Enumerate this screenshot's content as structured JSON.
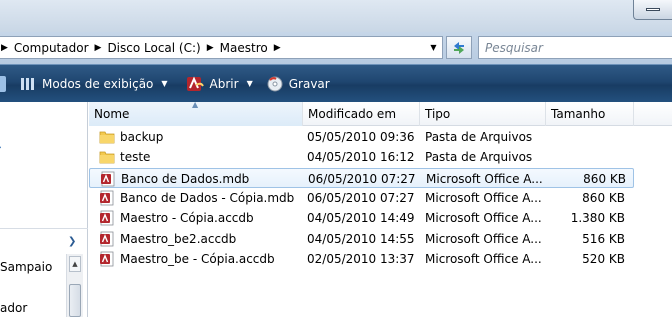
{
  "address": {
    "crumbs": [
      "Computador",
      "Disco Local (C:)",
      "Maestro"
    ],
    "search_placeholder": "Pesquisar"
  },
  "toolbar": {
    "views_label": "Modos de exibição",
    "open_label": "Abrir",
    "burn_label": "Gravar"
  },
  "nav": {
    "items": [
      "Sampaio",
      "ador"
    ]
  },
  "columns": {
    "name": "Nome",
    "modified": "Modificado em",
    "type": "Tipo",
    "size": "Tamanho"
  },
  "files": [
    {
      "name": "backup",
      "modified": "05/05/2010 09:36",
      "type": "Pasta de Arquivos",
      "size": "",
      "icon": "folder-icon"
    },
    {
      "name": "teste",
      "modified": "04/05/2010 16:12",
      "type": "Pasta de Arquivos",
      "size": "",
      "icon": "folder-icon"
    },
    {
      "name": "Banco de Dados.mdb",
      "modified": "06/05/2010 07:27",
      "type": "Microsoft Office A...",
      "size": "860 KB",
      "icon": "access-file-icon",
      "selected": true
    },
    {
      "name": "Banco de Dados - Cópia.mdb",
      "modified": "06/05/2010 07:27",
      "type": "Microsoft Office A...",
      "size": "860 KB",
      "icon": "access-file-icon"
    },
    {
      "name": "Maestro - Cópia.accdb",
      "modified": "04/05/2010 14:49",
      "type": "Microsoft Office A...",
      "size": "1.380 KB",
      "icon": "access-file-icon"
    },
    {
      "name": "Maestro_be2.accdb",
      "modified": "04/05/2010 14:55",
      "type": "Microsoft Office A...",
      "size": "516 KB",
      "icon": "access-file-icon"
    },
    {
      "name": "Maestro_be - Cópia.accdb",
      "modified": "02/05/2010 13:37",
      "type": "Microsoft Office A...",
      "size": "520 KB",
      "icon": "access-file-icon"
    }
  ],
  "colors": {
    "commandbar": "#1f4670",
    "selection_border": "#9fc3e6",
    "folder": "#f3c94f",
    "access_icon": "#b3262d"
  }
}
